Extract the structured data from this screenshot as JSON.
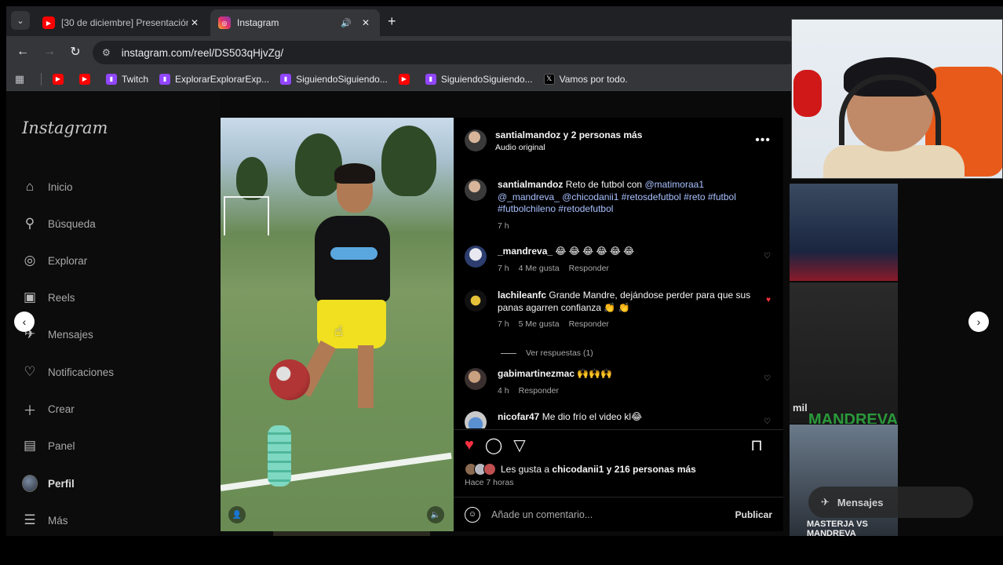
{
  "browser": {
    "tabs": [
      {
        "title": "[30 de diciembre] Presentación",
        "favicon": "youtube-icon",
        "active": false
      },
      {
        "title": "Instagram",
        "favicon": "instagram-icon",
        "active": true
      }
    ],
    "url": "instagram.com/reel/DS503qHjvZg/",
    "bookmarks": [
      {
        "label": "",
        "icon": "youtube-icon"
      },
      {
        "label": "",
        "icon": "youtube-icon"
      },
      {
        "label": "Twitch",
        "icon": "twitch-icon"
      },
      {
        "label": "ExplorarExplorarExp...",
        "icon": "twitch-icon"
      },
      {
        "label": "SiguiendoSiguiendo...",
        "icon": "twitch-icon"
      },
      {
        "label": "",
        "icon": "youtube-icon"
      },
      {
        "label": "SiguiendoSiguiendo...",
        "icon": "twitch-icon"
      },
      {
        "label": "Vamos por todo.",
        "icon": "x-icon"
      }
    ]
  },
  "sidebar": {
    "logo": "Instagram",
    "items": [
      {
        "label": "Inicio",
        "icon": "home-icon"
      },
      {
        "label": "Búsqueda",
        "icon": "search-icon"
      },
      {
        "label": "Explorar",
        "icon": "compass-icon"
      },
      {
        "label": "Reels",
        "icon": "reels-icon"
      },
      {
        "label": "Mensajes",
        "icon": "messenger-icon"
      },
      {
        "label": "Notificaciones",
        "icon": "heart-icon"
      },
      {
        "label": "Crear",
        "icon": "plus-icon"
      },
      {
        "label": "Panel",
        "icon": "chart-icon"
      },
      {
        "label": "Perfil",
        "icon": "avatar"
      },
      {
        "label": "Más",
        "icon": "menu-icon"
      }
    ]
  },
  "post": {
    "header_user": "santialmandoz y 2 personas más",
    "header_sub": "Audio original",
    "caption": {
      "user": "santialmandoz",
      "text": "Reto de futbol con",
      "tags": "@matimoraa1 @_mandreva_ @chicodanii1 #retosdefutbol #reto #futbol #futbolchileno #retodefutbol",
      "time": "7 h"
    },
    "comments": [
      {
        "user": "_mandreva_",
        "text": "😂 😂 😂 😂 😂 😂",
        "time": "7 h",
        "likes": "4 Me gusta",
        "reply": "Responder",
        "liked": false
      },
      {
        "user": "lachileanfc",
        "text": "Grande Mandre, dejándose perder para que sus panas agarren confianza 👏 👏",
        "time": "7 h",
        "likes": "5 Me gusta",
        "reply": "Responder",
        "liked": true
      },
      {
        "user": "gabimartinezmac",
        "text": "🙌🙌🙌",
        "time": "4 h",
        "likes": "",
        "reply": "Responder",
        "liked": false
      },
      {
        "user": "nicofar47",
        "text": "Me dio frío el video kl😂",
        "time": "",
        "likes": "",
        "reply": "",
        "liked": false
      }
    ],
    "view_replies": "Ver respuestas (1)",
    "likes_prefix": "Les gusta a",
    "likes_user": "chicodanii1",
    "likes_suffix": "y 216 personas más",
    "posted": "Hace 7 horas",
    "comment_placeholder": "Añade un comentario...",
    "publish": "Publicar"
  },
  "background": {
    "thumb_label": "mil",
    "thumb_banner": "MANDREVA",
    "bottom_banner": "MASTERJA VS MANDREVA",
    "chat_pill": "Mensajes"
  },
  "colors": {
    "like_red": "#ff3040",
    "link_blue": "#a8c0ff",
    "youtube_red": "#ff0000",
    "twitch_purple": "#9146ff"
  }
}
